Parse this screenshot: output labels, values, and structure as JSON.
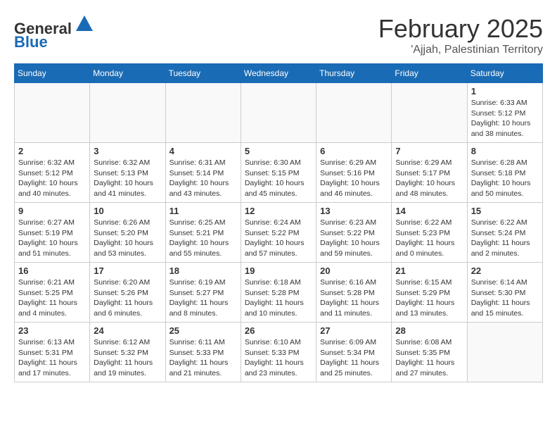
{
  "header": {
    "logo_line1": "General",
    "logo_line2": "Blue",
    "month": "February 2025",
    "location": "'Ajjah, Palestinian Territory"
  },
  "weekdays": [
    "Sunday",
    "Monday",
    "Tuesday",
    "Wednesday",
    "Thursday",
    "Friday",
    "Saturday"
  ],
  "weeks": [
    [
      {
        "day": "",
        "info": ""
      },
      {
        "day": "",
        "info": ""
      },
      {
        "day": "",
        "info": ""
      },
      {
        "day": "",
        "info": ""
      },
      {
        "day": "",
        "info": ""
      },
      {
        "day": "",
        "info": ""
      },
      {
        "day": "1",
        "info": "Sunrise: 6:33 AM\nSunset: 5:12 PM\nDaylight: 10 hours and 38 minutes."
      }
    ],
    [
      {
        "day": "2",
        "info": "Sunrise: 6:32 AM\nSunset: 5:12 PM\nDaylight: 10 hours and 40 minutes."
      },
      {
        "day": "3",
        "info": "Sunrise: 6:32 AM\nSunset: 5:13 PM\nDaylight: 10 hours and 41 minutes."
      },
      {
        "day": "4",
        "info": "Sunrise: 6:31 AM\nSunset: 5:14 PM\nDaylight: 10 hours and 43 minutes."
      },
      {
        "day": "5",
        "info": "Sunrise: 6:30 AM\nSunset: 5:15 PM\nDaylight: 10 hours and 45 minutes."
      },
      {
        "day": "6",
        "info": "Sunrise: 6:29 AM\nSunset: 5:16 PM\nDaylight: 10 hours and 46 minutes."
      },
      {
        "day": "7",
        "info": "Sunrise: 6:29 AM\nSunset: 5:17 PM\nDaylight: 10 hours and 48 minutes."
      },
      {
        "day": "8",
        "info": "Sunrise: 6:28 AM\nSunset: 5:18 PM\nDaylight: 10 hours and 50 minutes."
      }
    ],
    [
      {
        "day": "9",
        "info": "Sunrise: 6:27 AM\nSunset: 5:19 PM\nDaylight: 10 hours and 51 minutes."
      },
      {
        "day": "10",
        "info": "Sunrise: 6:26 AM\nSunset: 5:20 PM\nDaylight: 10 hours and 53 minutes."
      },
      {
        "day": "11",
        "info": "Sunrise: 6:25 AM\nSunset: 5:21 PM\nDaylight: 10 hours and 55 minutes."
      },
      {
        "day": "12",
        "info": "Sunrise: 6:24 AM\nSunset: 5:22 PM\nDaylight: 10 hours and 57 minutes."
      },
      {
        "day": "13",
        "info": "Sunrise: 6:23 AM\nSunset: 5:22 PM\nDaylight: 10 hours and 59 minutes."
      },
      {
        "day": "14",
        "info": "Sunrise: 6:22 AM\nSunset: 5:23 PM\nDaylight: 11 hours and 0 minutes."
      },
      {
        "day": "15",
        "info": "Sunrise: 6:22 AM\nSunset: 5:24 PM\nDaylight: 11 hours and 2 minutes."
      }
    ],
    [
      {
        "day": "16",
        "info": "Sunrise: 6:21 AM\nSunset: 5:25 PM\nDaylight: 11 hours and 4 minutes."
      },
      {
        "day": "17",
        "info": "Sunrise: 6:20 AM\nSunset: 5:26 PM\nDaylight: 11 hours and 6 minutes."
      },
      {
        "day": "18",
        "info": "Sunrise: 6:19 AM\nSunset: 5:27 PM\nDaylight: 11 hours and 8 minutes."
      },
      {
        "day": "19",
        "info": "Sunrise: 6:18 AM\nSunset: 5:28 PM\nDaylight: 11 hours and 10 minutes."
      },
      {
        "day": "20",
        "info": "Sunrise: 6:16 AM\nSunset: 5:28 PM\nDaylight: 11 hours and 11 minutes."
      },
      {
        "day": "21",
        "info": "Sunrise: 6:15 AM\nSunset: 5:29 PM\nDaylight: 11 hours and 13 minutes."
      },
      {
        "day": "22",
        "info": "Sunrise: 6:14 AM\nSunset: 5:30 PM\nDaylight: 11 hours and 15 minutes."
      }
    ],
    [
      {
        "day": "23",
        "info": "Sunrise: 6:13 AM\nSunset: 5:31 PM\nDaylight: 11 hours and 17 minutes."
      },
      {
        "day": "24",
        "info": "Sunrise: 6:12 AM\nSunset: 5:32 PM\nDaylight: 11 hours and 19 minutes."
      },
      {
        "day": "25",
        "info": "Sunrise: 6:11 AM\nSunset: 5:33 PM\nDaylight: 11 hours and 21 minutes."
      },
      {
        "day": "26",
        "info": "Sunrise: 6:10 AM\nSunset: 5:33 PM\nDaylight: 11 hours and 23 minutes."
      },
      {
        "day": "27",
        "info": "Sunrise: 6:09 AM\nSunset: 5:34 PM\nDaylight: 11 hours and 25 minutes."
      },
      {
        "day": "28",
        "info": "Sunrise: 6:08 AM\nSunset: 5:35 PM\nDaylight: 11 hours and 27 minutes."
      },
      {
        "day": "",
        "info": ""
      }
    ]
  ]
}
